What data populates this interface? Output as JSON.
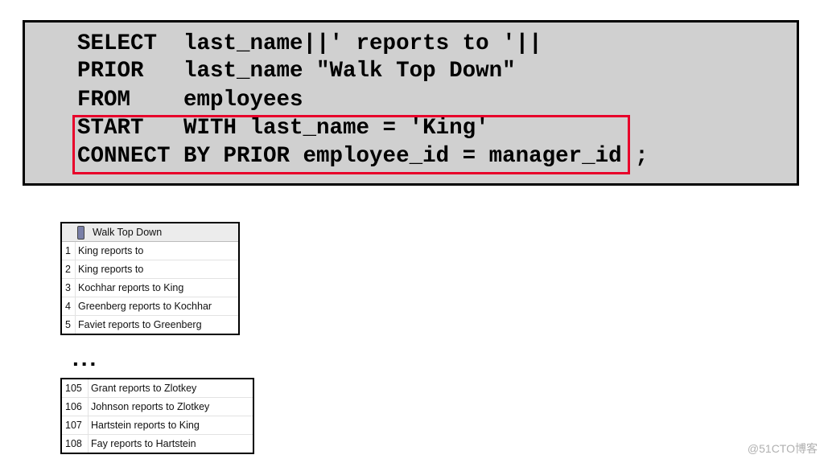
{
  "sql": {
    "lines": [
      "SELECT  last_name||' reports to '||",
      "PRIOR   last_name \"Walk Top Down\"",
      "FROM    employees",
      "START   WITH last_name = 'King'",
      "CONNECT BY PRIOR employee_id = manager_id ;"
    ],
    "highlight_color": "#e8002a"
  },
  "result_top": {
    "header": "Walk Top Down",
    "rows": [
      {
        "n": "1",
        "v": "King reports to"
      },
      {
        "n": "2",
        "v": "King reports to"
      },
      {
        "n": "3",
        "v": "Kochhar reports to King"
      },
      {
        "n": "4",
        "v": "Greenberg reports to Kochhar"
      },
      {
        "n": "5",
        "v": "Faviet reports to Greenberg"
      }
    ]
  },
  "ellipsis": "...",
  "result_bottom": {
    "rows": [
      {
        "n": "105",
        "v": "Grant reports to Zlotkey"
      },
      {
        "n": "106",
        "v": "Johnson reports to Zlotkey"
      },
      {
        "n": "107",
        "v": "Hartstein reports to King"
      },
      {
        "n": "108",
        "v": "Fay reports to Hartstein"
      }
    ]
  },
  "watermark": "@51CTO博客"
}
